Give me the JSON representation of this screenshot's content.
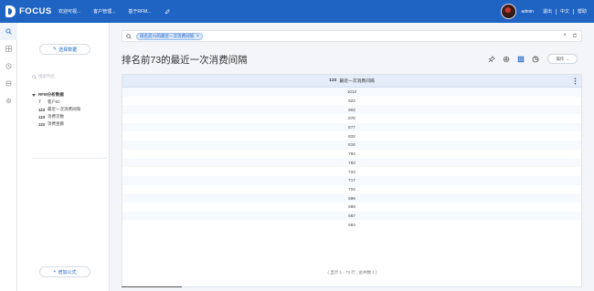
{
  "header": {
    "logo_text": "FOCUS",
    "nav": [
      "欢迎可视...",
      "客户管理...",
      "基于RFM..."
    ],
    "user": "admin",
    "links": [
      "退出",
      "中文",
      "帮助"
    ]
  },
  "rail": {
    "icons": [
      "search-icon",
      "grid-icon",
      "history-icon",
      "database-icon",
      "settings-icon"
    ]
  },
  "panel": {
    "select_data_label": "选择数据",
    "search_placeholder": "搜索列名",
    "table_name": "RFM分析数据",
    "fields": [
      {
        "type": "T",
        "name": "客户ID"
      },
      {
        "type": "123",
        "name": "最近一次消费间隔"
      },
      {
        "type": "123",
        "name": "消费次数"
      },
      {
        "type": "123",
        "name": "消费金额"
      }
    ],
    "add_formula_label": "增加公式"
  },
  "query": {
    "chip": "排名前73的最近一次消费间隔"
  },
  "main": {
    "title": "排名前73的最近一次消费间隔",
    "op_label": "操作"
  },
  "table": {
    "column_type": "123",
    "column_name": "最近一次消费间隔",
    "rows": [
      "1012",
      "922",
      "902",
      "878",
      "877",
      "832",
      "816",
      "784",
      "783",
      "722",
      "717",
      "704",
      "699",
      "689",
      "667",
      "664"
    ]
  },
  "footer": {
    "note": "( 显示 1 - 73 行 , 总共数 1 )"
  },
  "colors": {
    "brand": "#1f63c3",
    "header_bg": "#e3ecf8",
    "chip_bg": "#d9e8fb"
  }
}
